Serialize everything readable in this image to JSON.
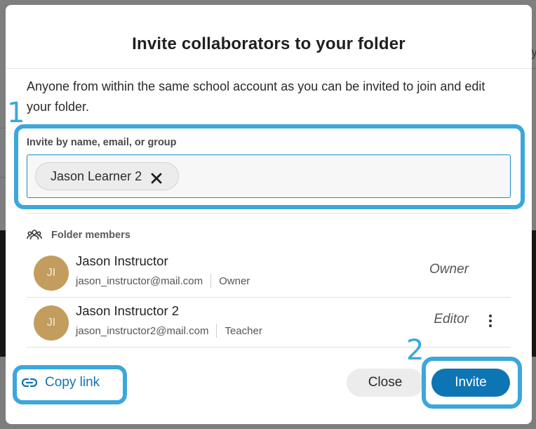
{
  "dialog": {
    "title": "Invite collaborators to your folder",
    "description": "Anyone from within the same school account as you can be invited to join and edit your folder."
  },
  "invite_field": {
    "label": "Invite by name, email, or group",
    "selected_chips": [
      {
        "label": "Jason Learner 2",
        "remove_icon": "close-icon"
      }
    ]
  },
  "members": {
    "header_label": "Folder members",
    "header_icon": "group-icon",
    "list": [
      {
        "initials": "JI",
        "name": "Jason Instructor",
        "email": "jason_instructor@mail.com",
        "account_role": "Owner",
        "folder_role": "Owner",
        "has_menu": false
      },
      {
        "initials": "JI",
        "name": "Jason Instructor 2",
        "email": "jason_instructor2@mail.com",
        "account_role": "Teacher",
        "folder_role": "Editor",
        "has_menu": true
      }
    ]
  },
  "footer": {
    "copy_link_label": "Copy link",
    "copy_link_icon": "link-icon",
    "close_label": "Close",
    "invite_label": "Invite"
  },
  "annotations": {
    "step1": "1",
    "step2": "2"
  },
  "colors": {
    "accent": "#0e75b4",
    "highlight": "#3ba7dc",
    "avatar": "#c39d5e"
  }
}
